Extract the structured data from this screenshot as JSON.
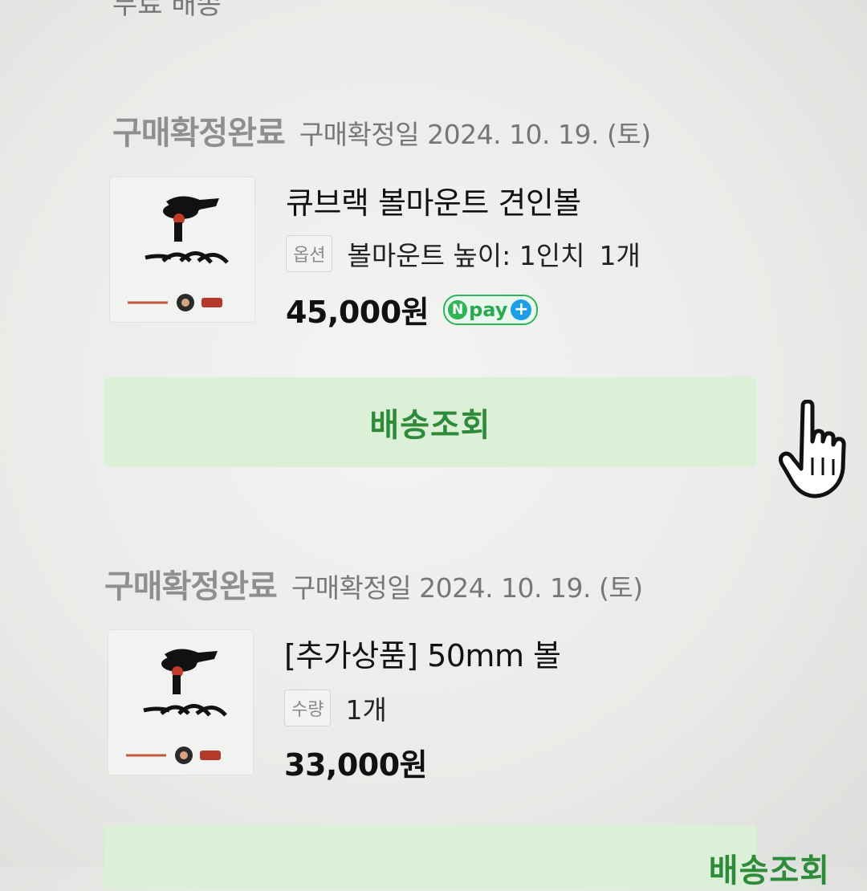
{
  "top_cut_text": "무료 배송",
  "orders": [
    {
      "status": "구매확정완료",
      "confirm_date": "구매확정일 2024. 10. 19. (토)",
      "product_name": "큐브랙 볼마운트 견인볼",
      "option_tag": "옵션",
      "option_value": "볼마운트 높이: 1인치",
      "quantity": "1개",
      "price": "45,000원",
      "npay": {
        "n": "N",
        "text": "pay",
        "plus": "+"
      },
      "button_label": "배송조회"
    },
    {
      "status": "구매확정완료",
      "confirm_date": "구매확정일 2024. 10. 19. (토)",
      "product_name": "[추가상품] 50mm 볼",
      "option_tag": "수량",
      "option_value": "1개",
      "price": "33,000원",
      "button_label": "배송조회"
    }
  ],
  "colors": {
    "accent_green": "#2e8b3a",
    "button_bg": "#dcefd7",
    "npay_green": "#2fb457",
    "npay_plus_blue": "#1e9ee8"
  },
  "icons": [
    "product-logo-icon",
    "hand-pointer-icon"
  ]
}
